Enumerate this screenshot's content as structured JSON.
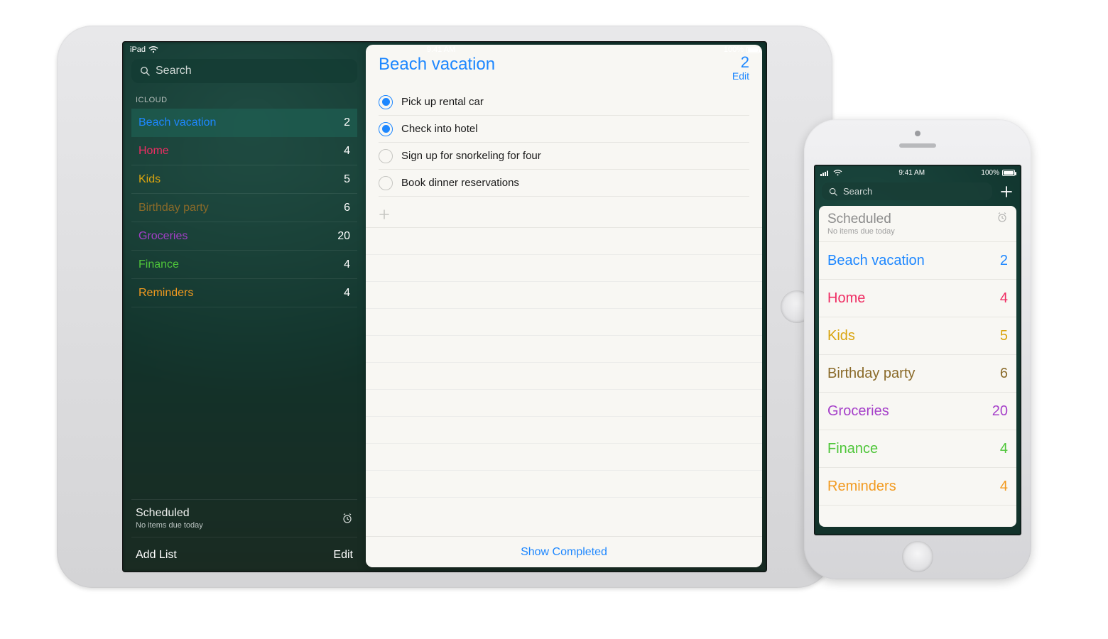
{
  "shared": {
    "time": "9:41 AM",
    "battery_text": "100%",
    "device_label_ipad": "iPad",
    "search_placeholder": "Search"
  },
  "colors": {
    "blue": "#1d87ff",
    "pink": "#ef2d63",
    "gold": "#d9a40f",
    "brown": "#8a6a29",
    "purple": "#a53fc9",
    "green": "#4fc63a",
    "orange": "#f29a1f"
  },
  "sidebar": {
    "section_label": "ICLOUD",
    "lists": [
      {
        "name": "Beach vacation",
        "count": 2,
        "colorKey": "blue",
        "selected": true
      },
      {
        "name": "Home",
        "count": 4,
        "colorKey": "pink",
        "selected": false
      },
      {
        "name": "Kids",
        "count": 5,
        "colorKey": "gold",
        "selected": false
      },
      {
        "name": "Birthday party",
        "count": 6,
        "colorKey": "brown",
        "selected": false
      },
      {
        "name": "Groceries",
        "count": 20,
        "colorKey": "purple",
        "selected": false
      },
      {
        "name": "Finance",
        "count": 4,
        "colorKey": "green",
        "selected": false
      },
      {
        "name": "Reminders",
        "count": 4,
        "colorKey": "orange",
        "selected": false
      }
    ],
    "scheduled_title": "Scheduled",
    "scheduled_sub": "No items due today",
    "footer_add": "Add List",
    "footer_edit": "Edit"
  },
  "detail": {
    "title": "Beach vacation",
    "count": 2,
    "edit_label": "Edit",
    "tasks": [
      {
        "text": "Pick up rental car",
        "marked": true
      },
      {
        "text": "Check into hotel",
        "marked": true
      },
      {
        "text": "Sign up for snorkeling for four",
        "marked": false
      },
      {
        "text": "Book dinner reservations",
        "marked": false
      }
    ],
    "show_completed": "Show Completed"
  },
  "iphone": {
    "scheduled_title": "Scheduled",
    "scheduled_sub": "No items due today"
  }
}
